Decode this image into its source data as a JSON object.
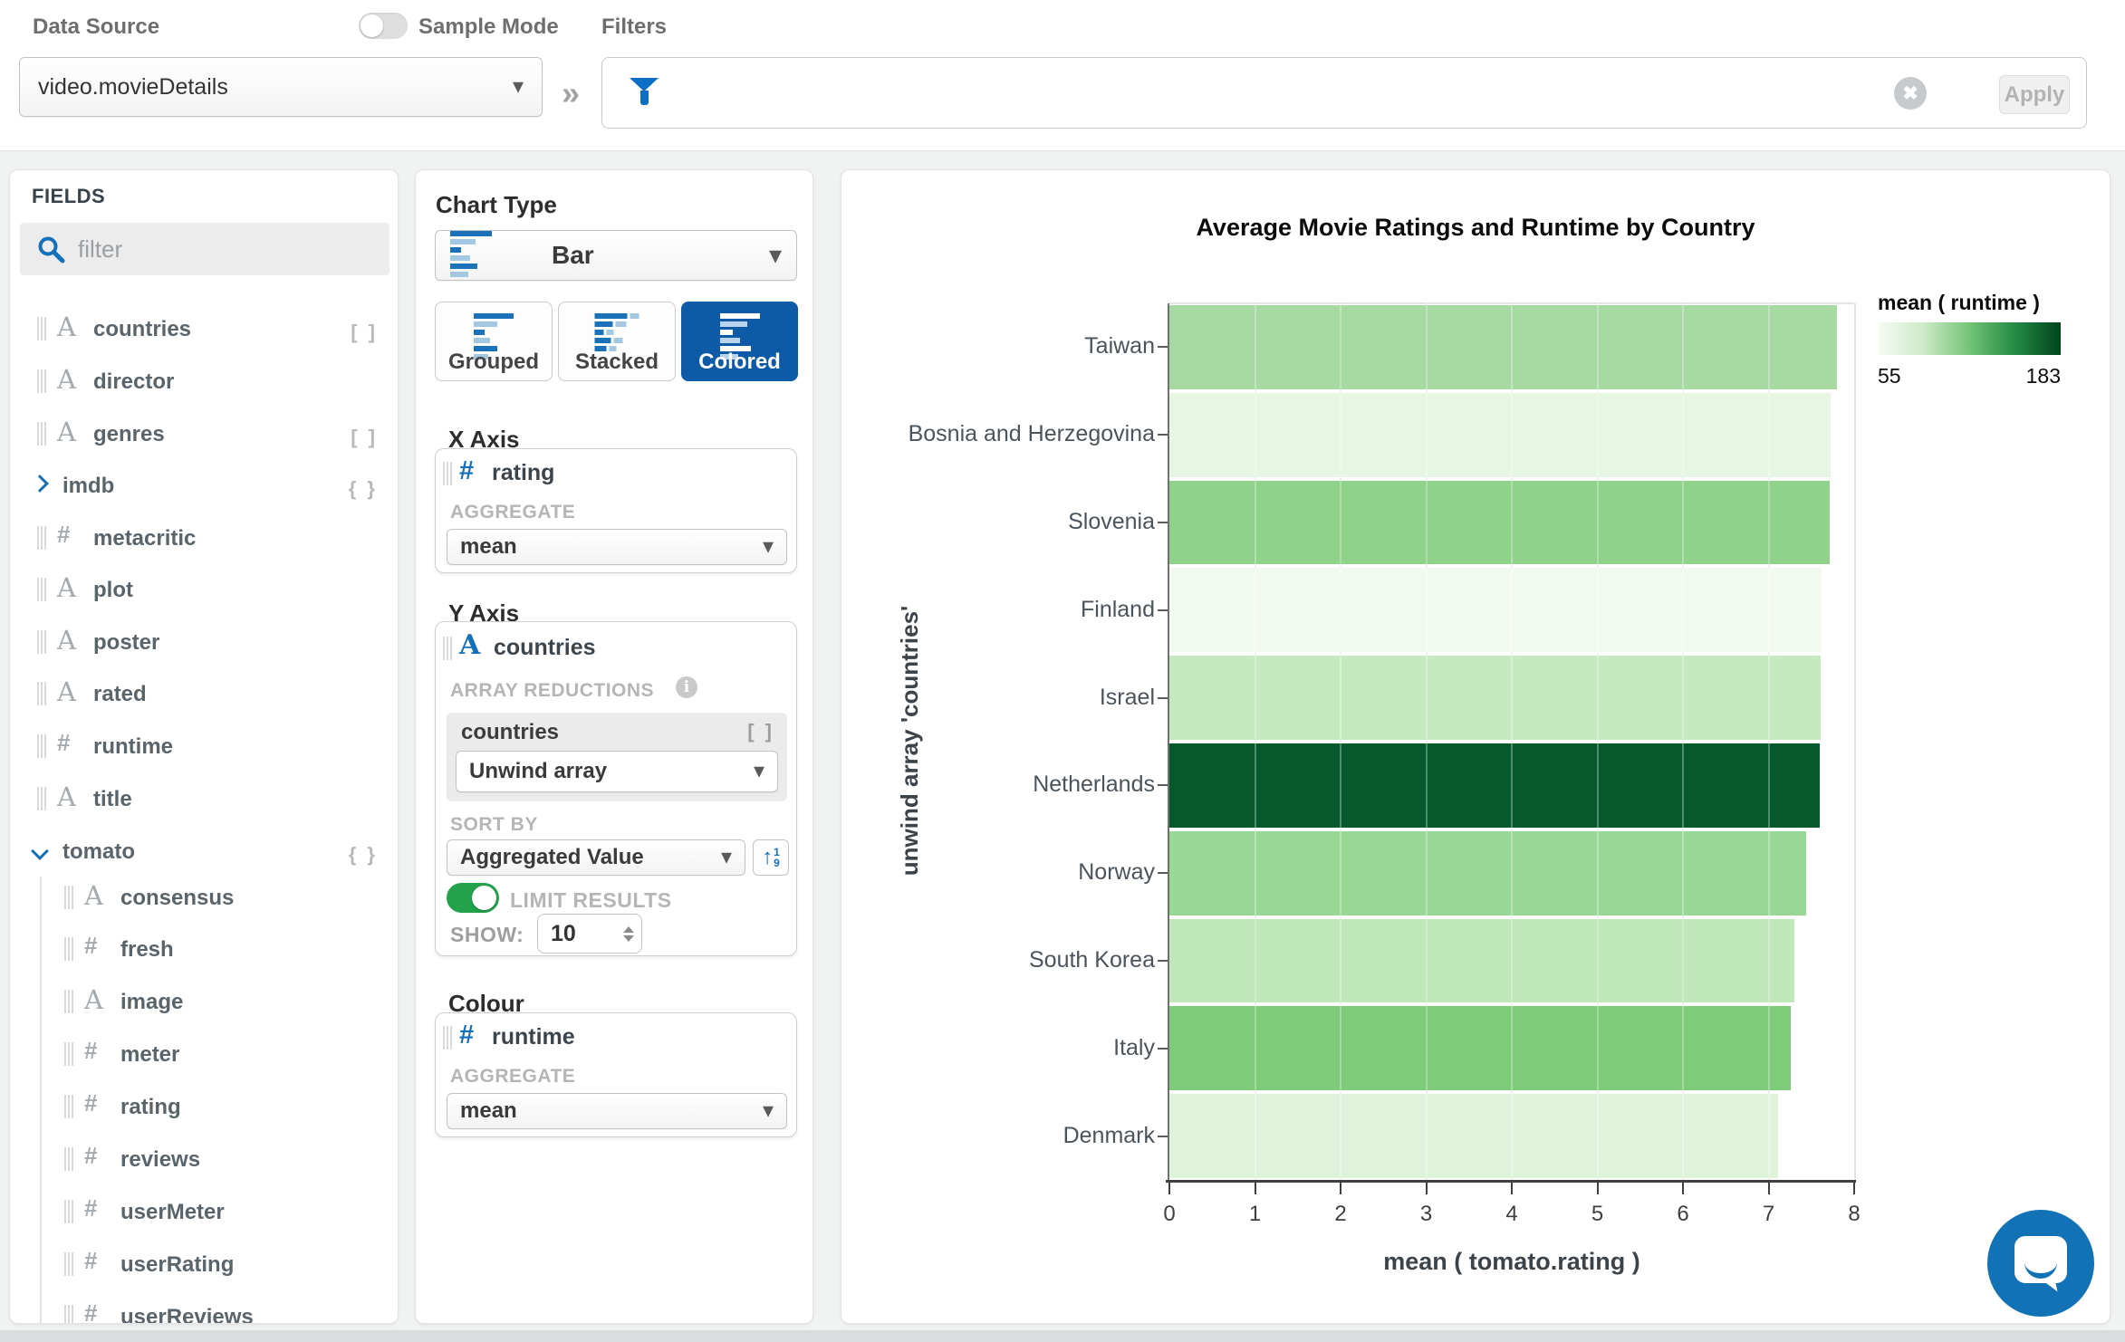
{
  "topbar": {
    "data_source_label": "Data Source",
    "sample_mode_label": "Sample Mode",
    "data_source_value": "video.movieDetails",
    "filters_label": "Filters",
    "apply_label": "Apply",
    "clear_icon": "close-circle-icon",
    "funnel_icon": "filter-funnel-icon"
  },
  "fields_panel": {
    "title": "FIELDS",
    "filter_placeholder": "filter",
    "partial_top_badge": "{ }",
    "items": [
      {
        "label": "countries",
        "type": "string",
        "badge": "[ ]",
        "child": false,
        "group": false
      },
      {
        "label": "director",
        "type": "string",
        "badge": "",
        "child": false,
        "group": false
      },
      {
        "label": "genres",
        "type": "string",
        "badge": "[ ]",
        "child": false,
        "group": false
      },
      {
        "label": "imdb",
        "type": "object",
        "badge": "{ }",
        "child": false,
        "group": true,
        "state": "collapsed"
      },
      {
        "label": "metacritic",
        "type": "number",
        "badge": "",
        "child": false,
        "group": false
      },
      {
        "label": "plot",
        "type": "string",
        "badge": "",
        "child": false,
        "group": false
      },
      {
        "label": "poster",
        "type": "string",
        "badge": "",
        "child": false,
        "group": false
      },
      {
        "label": "rated",
        "type": "string",
        "badge": "",
        "child": false,
        "group": false
      },
      {
        "label": "runtime",
        "type": "number",
        "badge": "",
        "child": false,
        "group": false
      },
      {
        "label": "title",
        "type": "string",
        "badge": "",
        "child": false,
        "group": false
      },
      {
        "label": "tomato",
        "type": "object",
        "badge": "{ }",
        "child": false,
        "group": true,
        "state": "expanded"
      },
      {
        "label": "consensus",
        "type": "string",
        "badge": "",
        "child": true,
        "group": false
      },
      {
        "label": "fresh",
        "type": "number",
        "badge": "",
        "child": true,
        "group": false
      },
      {
        "label": "image",
        "type": "string",
        "badge": "",
        "child": true,
        "group": false
      },
      {
        "label": "meter",
        "type": "number",
        "badge": "",
        "child": true,
        "group": false
      },
      {
        "label": "rating",
        "type": "number",
        "badge": "",
        "child": true,
        "group": false
      },
      {
        "label": "reviews",
        "type": "number",
        "badge": "",
        "child": true,
        "group": false
      },
      {
        "label": "userMeter",
        "type": "number",
        "badge": "",
        "child": true,
        "group": false
      },
      {
        "label": "userRating",
        "type": "number",
        "badge": "",
        "child": true,
        "group": false
      },
      {
        "label": "userReviews",
        "type": "number",
        "badge": "",
        "child": true,
        "group": false,
        "clipped": true
      }
    ]
  },
  "builder": {
    "chart_type_label": "Chart Type",
    "chart_type_value": "Bar",
    "modes": [
      {
        "label": "Grouped",
        "selected": false
      },
      {
        "label": "Stacked",
        "selected": false
      },
      {
        "label": "Colored",
        "selected": true
      }
    ],
    "x_axis": {
      "title": "X Axis",
      "field": "rating",
      "aggregate_label": "AGGREGATE",
      "aggregate_value": "mean"
    },
    "y_axis": {
      "title": "Y Axis",
      "field": "countries",
      "array_reductions_label": "ARRAY REDUCTIONS",
      "reduction_field": "countries",
      "reduction_badge": "[ ]",
      "reduction_value": "Unwind array",
      "sort_by_label": "SORT BY",
      "sort_by_value": "Aggregated Value",
      "limit_results_label": "LIMIT RESULTS",
      "limit_on": true,
      "show_label": "SHOW:",
      "show_value": "10"
    },
    "colour": {
      "title": "Colour",
      "field": "runtime",
      "aggregate_label": "AGGREGATE",
      "aggregate_value": "mean"
    }
  },
  "chart_data": {
    "type": "bar",
    "orientation": "horizontal",
    "title": "Average Movie Ratings and Runtime by Country",
    "xlabel": "mean ( tomato.rating )",
    "ylabel": "unwind array 'countries'",
    "xlim": [
      0,
      8
    ],
    "x_ticks": [
      0,
      1,
      2,
      3,
      4,
      5,
      6,
      7,
      8
    ],
    "grid": true,
    "categories": [
      "Taiwan",
      "Bosnia and Herzegovina",
      "Slovenia",
      "Finland",
      "Israel",
      "Netherlands",
      "Norway",
      "South Korea",
      "Italy",
      "Denmark"
    ],
    "values": [
      7.8,
      7.72,
      7.71,
      7.62,
      7.61,
      7.6,
      7.44,
      7.3,
      7.26,
      7.11
    ],
    "bar_colors": [
      "#a7d9a3",
      "#e7f6e3",
      "#8fd28a",
      "#f2faf0",
      "#c5e9bf",
      "#05592b",
      "#99d794",
      "#c0e7ba",
      "#7ecb7a",
      "#dff2da"
    ],
    "legend": {
      "title": "mean ( runtime )",
      "min": 55,
      "max": 183,
      "position": "top-right",
      "colors": [
        "#f7fcf5",
        "#cdeac7",
        "#74c476",
        "#238b45",
        "#00441b"
      ]
    }
  }
}
